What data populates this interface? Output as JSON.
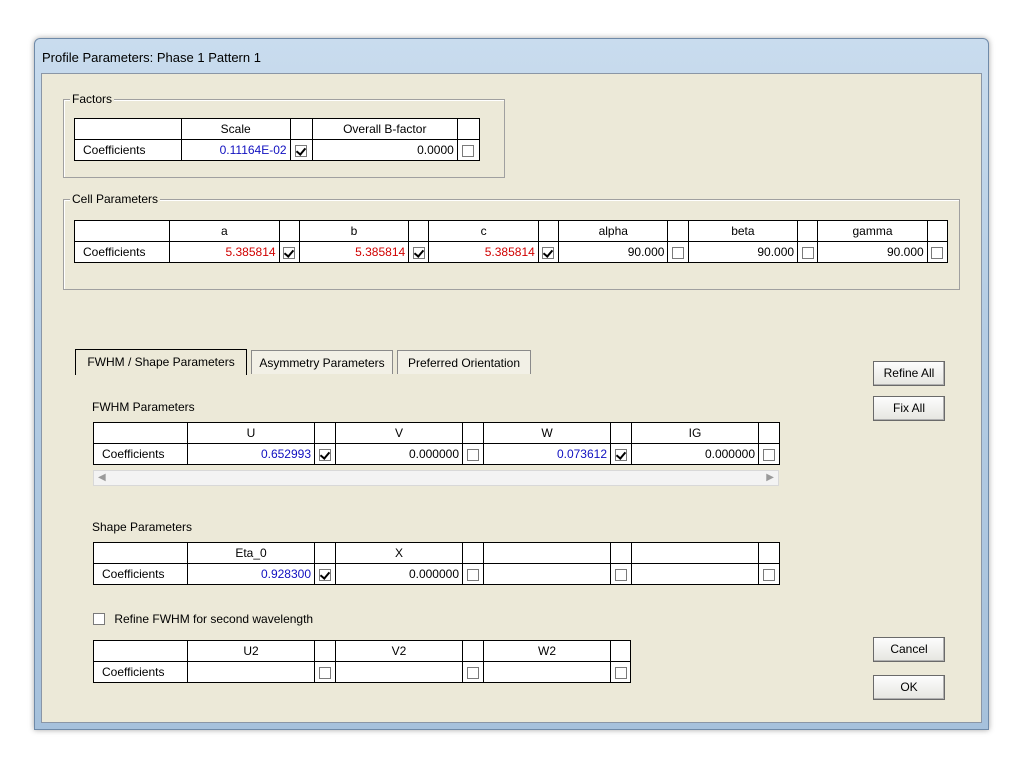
{
  "window": {
    "title": "Profile Parameters: Phase  1   Pattern 1"
  },
  "factors": {
    "legend": "Factors",
    "headers": [
      "Scale",
      "Overall B-factor"
    ],
    "row_label": "Coefficients",
    "values": [
      "0.11164E-02",
      "0.0000"
    ],
    "refined": [
      true,
      false
    ]
  },
  "cell": {
    "legend": "Cell Parameters",
    "headers": [
      "a",
      "b",
      "c",
      "alpha",
      "beta",
      "gamma"
    ],
    "row_label": "Coefficients",
    "values": [
      "5.385814",
      "5.385814",
      "5.385814",
      "90.000",
      "90.000",
      "90.000"
    ],
    "refined": [
      true,
      true,
      true,
      false,
      false,
      false
    ]
  },
  "tabs": [
    {
      "label": "FWHM / Shape Parameters",
      "active": true
    },
    {
      "label": "Asymmetry Parameters",
      "active": false
    },
    {
      "label": "Preferred Orientation",
      "active": false
    }
  ],
  "fwhm": {
    "section_label": "FWHM Parameters",
    "headers": [
      "U",
      "V",
      "W",
      "IG"
    ],
    "row_label": "Coefficients",
    "values": [
      "0.652993",
      "0.000000",
      "0.073612",
      "0.000000"
    ],
    "refined": [
      true,
      false,
      true,
      false
    ]
  },
  "shape": {
    "section_label": "Shape Parameters",
    "headers": [
      "Eta_0",
      "X",
      "",
      ""
    ],
    "row_label": "Coefficients",
    "values": [
      "0.928300",
      "0.000000",
      "",
      ""
    ],
    "refined": [
      true,
      false,
      false,
      false
    ]
  },
  "second_wavelength": {
    "checkbox_label": "Refine FWHM for second wavelength",
    "checked": false,
    "headers": [
      "U2",
      "V2",
      "W2"
    ],
    "row_label": "Coefficients",
    "values": [
      "",
      "",
      ""
    ],
    "refined": [
      false,
      false,
      false
    ]
  },
  "buttons": {
    "refine_all": "Refine All",
    "fix_all": "Fix All",
    "cancel": "Cancel",
    "ok": "OK"
  },
  "colors": {
    "refined_value": "#d00000",
    "variable_value": "#1010c0",
    "window_frame": "#b5cde4",
    "client": "#ece9d8"
  }
}
